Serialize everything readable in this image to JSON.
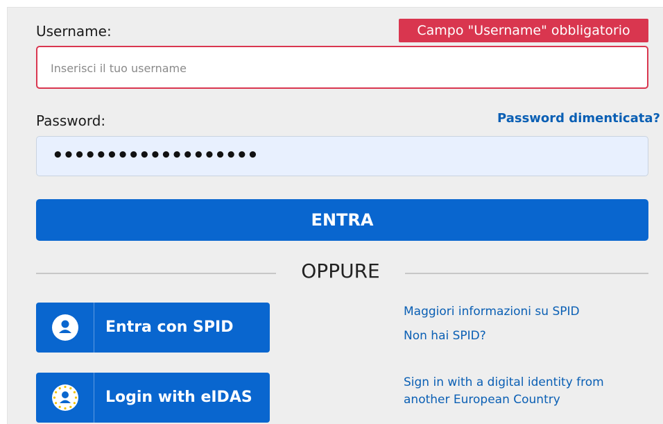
{
  "form": {
    "username_label": "Username:",
    "username_error": "Campo \"Username\" obbligatorio",
    "username_placeholder": "Inserisci il tuo username",
    "password_label": "Password:",
    "password_masked": "•••••••••••••••••••",
    "forgot_password": "Password dimenticata?",
    "submit_label": "ENTRA",
    "separator": "OPPURE"
  },
  "identity_options": [
    {
      "label": "Entra con SPID",
      "icon": "user-icon",
      "links": [
        "Maggiori informazioni su SPID",
        "Non hai SPID?"
      ]
    },
    {
      "label": "Login with eIDAS",
      "icon": "eu-user-icon",
      "links": [
        "Sign in with a digital identity from",
        "another European Country"
      ]
    }
  ],
  "colors": {
    "primary": "#0966cf",
    "error": "#d9364f",
    "link": "#0a5fb4",
    "panel_bg": "#eeeeee",
    "autofill_bg": "#e8f0fe"
  }
}
